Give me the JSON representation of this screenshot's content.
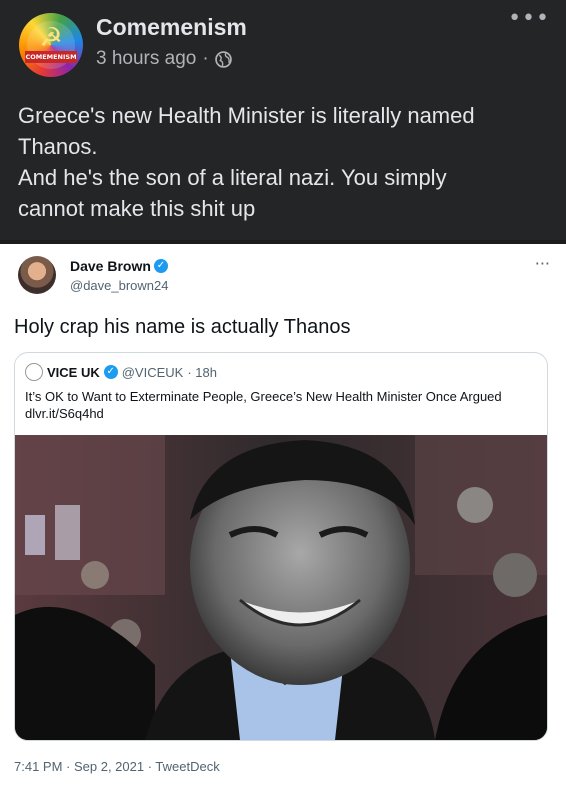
{
  "facebook_post": {
    "page_name": "Comemenism",
    "avatar_tag": "COMEMENISM",
    "timestamp": "3 hours ago",
    "separator": "·",
    "privacy_icon": "globe-icon",
    "more_icon": "more-horizontal-icon",
    "text_lines": [
      "Greece's new Health Minister is literally named",
      "Thanos.",
      "And he's the son of a literal nazi. You simply",
      "cannot make this shit up"
    ]
  },
  "tweet": {
    "author_name": "Dave Brown",
    "author_handle": "@dave_brown24",
    "text": "Holy crap his name is actually Thanos",
    "more_icon": "more-horizontal-icon",
    "quoted": {
      "author_name": "VICE UK",
      "author_handle": "@VICEUK",
      "age": "· 18h",
      "text": "It’s OK to Want to Exterminate People, Greece’s New Health Minister Once Argued dlvr.it/S6q4hd"
    },
    "footer": "7:41 PM · Sep 2, 2021 · TweetDeck"
  },
  "colors": {
    "facebook_bg": "#242526",
    "verified_blue": "#1d9bf0"
  }
}
